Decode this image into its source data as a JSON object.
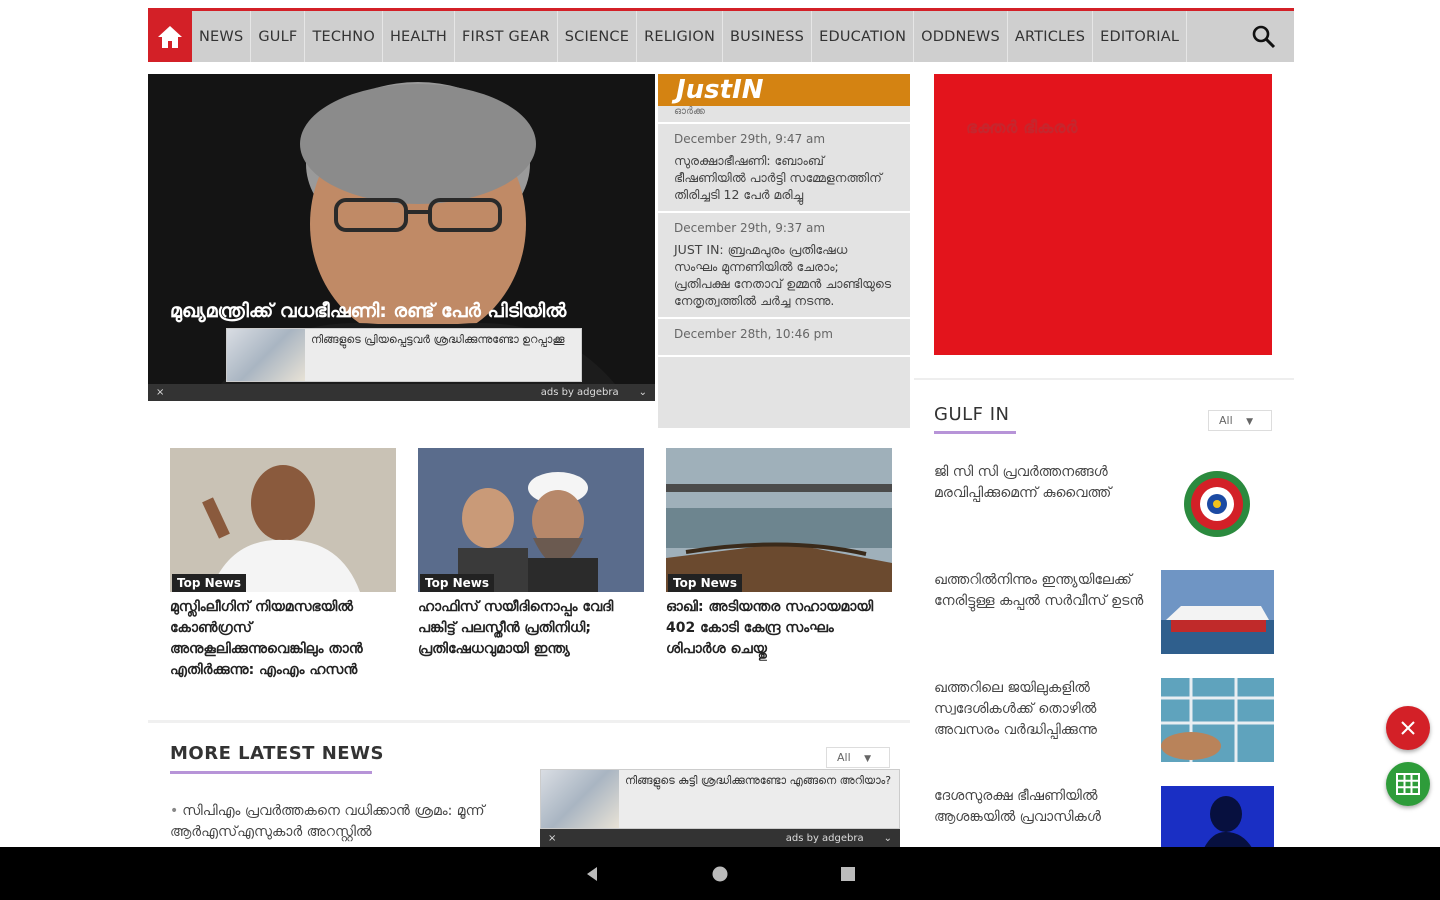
{
  "nav": {
    "items": [
      "NEWS",
      "GULF",
      "TECHNO",
      "HEALTH",
      "FIRST GEAR",
      "SCIENCE",
      "RELIGION",
      "BUSINESS",
      "EDUCATION",
      "ODDNEWS",
      "ARTICLES",
      "EDITORIAL"
    ]
  },
  "hero": {
    "headline": "മുഖ്യമന്ത്രിക്ക് വധഭീഷണി: രണ്ട് പേർ പിടിയിൽ",
    "ad_text": "നിങ്ങളുടെ പ്രിയപ്പെട്ടവർ ശ്രദ്ധിക്കുന്നുണ്ടോ ഉറപ്പാക്കൂ",
    "ad_credit": "ads by adgebra",
    "ad_close": "×",
    "ad_caret": "⌄"
  },
  "justin": {
    "title": "JustIN",
    "top_stub": "ഓർക്ക",
    "items": [
      {
        "date": "December 29th, 9:47 am",
        "text": "സുരക്ഷാഭീഷണി: ബോംബ് ഭീഷണിയിൽ പാർട്ടി സമ്മേളനത്തിന് തിരിച്ചടി 12 പേർ മരിച്ചു"
      },
      {
        "date": "December 29th, 9:37 am",
        "text": "JUST IN: ബ്രഹ്മപുരം പ്രതിഷേധ സംഘം മുന്നണിയിൽ ചേരാം; പ്രതിപക്ഷ നേതാവ് ഉമ്മൻ ചാണ്ടിയുടെ നേതൃത്വത്തിൽ ചർച്ച നടന്നു."
      },
      {
        "date": "December 28th, 10:46 pm",
        "text": ""
      }
    ]
  },
  "red_ad": {
    "text": "ഭക്തർ ഭീകരർ"
  },
  "gulf": {
    "title": "GULF IN",
    "dropdown": "All",
    "items": [
      {
        "text": "ജി സി സി പ്രവർത്തനങ്ങൾ മരവിപ്പിക്കുമെന്ന് കുവൈത്ത്"
      },
      {
        "text": "ഖത്തറിൽനിന്നും ഇന്ത്യയിലേക്ക് നേരിട്ടുള്ള കപ്പൽ സർവീസ് ഉടൻ"
      },
      {
        "text": "ഖത്തറിലെ ജയിലുകളിൽ സ്വദേശികൾക്ക് തൊഴിൽ അവസരം വർദ്ധിപ്പിക്കുന്നു"
      },
      {
        "text": "ദേശസുരക്ഷ ഭീഷണിയിൽ ആശങ്കയിൽ പ്രവാസികൾ"
      }
    ]
  },
  "cards": [
    {
      "badge": "Top News",
      "text": "മുസ്ലിംലീഗിന് നിയമസഭയിൽ കോൺഗ്രസ് അനുകൂലിക്കുന്നുവെങ്കിലും താൻ എതിർക്കുന്നു: എംഎം ഹസൻ"
    },
    {
      "badge": "Top News",
      "text": "ഹാഫിസ് സയീദിനൊപ്പം വേദി പങ്കിട്ട് പലസ്തീൻ പ്രതിനിധി; പ്രതിഷേധവുമായി ഇന്ത്യ"
    },
    {
      "badge": "Top News",
      "text": "ഓഖി: അടിയന്തര സഹായമായി 402 കോടി കേന്ദ്ര സംഘം ശിപാർശ ചെയ്തു"
    }
  ],
  "latest": {
    "title": "MORE LATEST NEWS",
    "dropdown": "All",
    "item": "സിപിഎം പ്രവർത്തകനെ വധിക്കാൻ ശ്രമം: മൂന്ന് ആർഎസ്എസുകാർ അറസ്റ്റിൽ",
    "ad_text": "നിങ്ങളുടെ കുട്ടി ശ്രദ്ധിക്കുന്നുണ്ടോ എങ്ങനെ അറിയാം?",
    "ad_credit": "ads by adgebra",
    "ad_close": "×",
    "ad_caret": "⌄"
  },
  "colors": {
    "brand_red": "#d32027",
    "accent_orange": "#d48312",
    "ad_red": "#e3141c",
    "fab_green": "#2e9c3a"
  }
}
